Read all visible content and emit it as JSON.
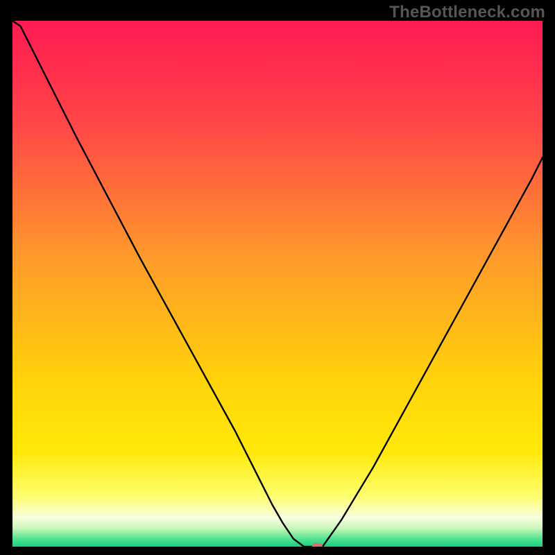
{
  "watermark": {
    "text": "TheBottleneck.com"
  },
  "chart_data": {
    "type": "line",
    "title": "",
    "xlabel": "",
    "ylabel": "",
    "xlim": [
      0,
      100
    ],
    "ylim": [
      0,
      100
    ],
    "background_gradient": {
      "stops": [
        {
          "offset": 0.0,
          "color": "#ff1a53"
        },
        {
          "offset": 0.2,
          "color": "#ff4747"
        },
        {
          "offset": 0.45,
          "color": "#ff9a2b"
        },
        {
          "offset": 0.68,
          "color": "#ffd20a"
        },
        {
          "offset": 0.82,
          "color": "#ffe90a"
        },
        {
          "offset": 0.905,
          "color": "#fdff70"
        },
        {
          "offset": 0.945,
          "color": "#fafde0"
        },
        {
          "offset": 0.965,
          "color": "#c8f7b9"
        },
        {
          "offset": 0.985,
          "color": "#52e28f"
        },
        {
          "offset": 1.0,
          "color": "#19cf86"
        }
      ]
    },
    "series": [
      {
        "name": "bottleneck-curve",
        "x": [
          0.0,
          1.5,
          6,
          12,
          18,
          24,
          30,
          36,
          42,
          47,
          49,
          51,
          53,
          55,
          57,
          58.5,
          62,
          68,
          74,
          80,
          86,
          92,
          98,
          100
        ],
        "y": [
          100,
          99,
          90,
          78,
          66.5,
          55,
          44,
          33,
          22,
          12,
          8,
          4.5,
          1.5,
          0.0,
          0.0,
          0.0,
          5,
          15,
          26,
          37,
          48,
          59,
          70,
          74
        ]
      }
    ],
    "marker": {
      "x": 57.5,
      "y": 0.0,
      "shape": "rounded-rect",
      "color": "#dd6f69"
    }
  }
}
